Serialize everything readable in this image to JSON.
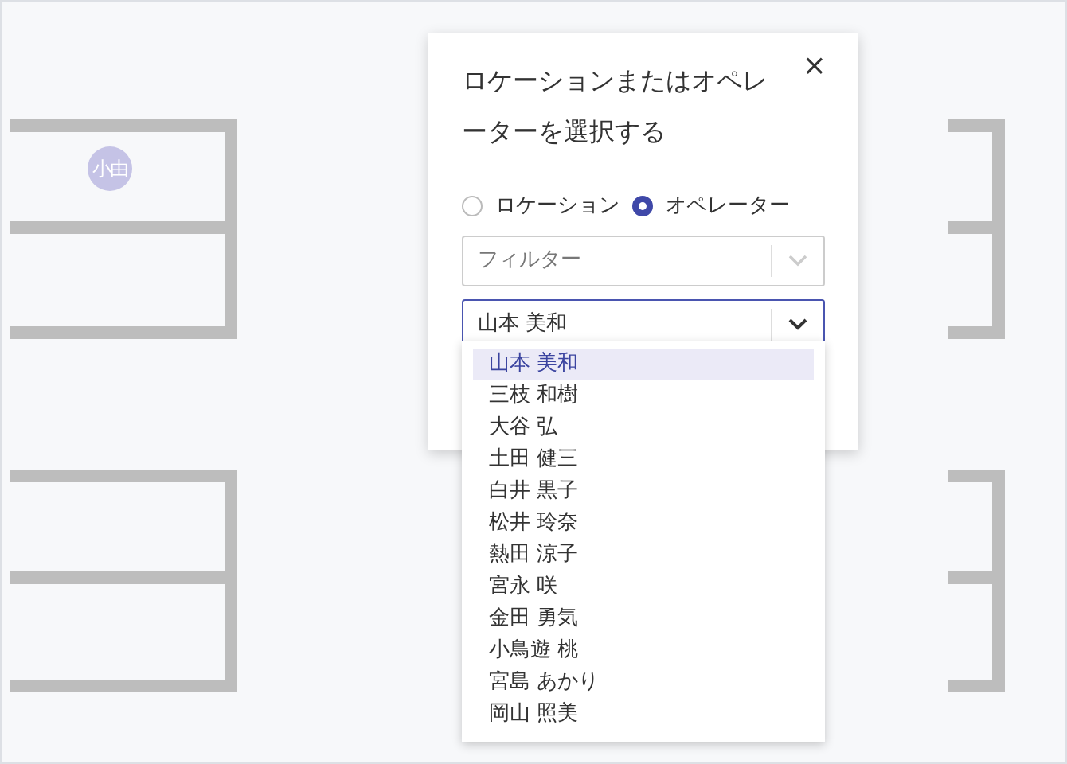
{
  "floor_plan": {
    "avatar": {
      "initials": "小由"
    }
  },
  "dialog": {
    "title": "ロケーションまたはオペレーターを選択する",
    "close": "×",
    "view_options": [
      {
        "label": "ロケーション",
        "selected": false
      },
      {
        "label": "オペレーター",
        "selected": true
      }
    ],
    "filter": {
      "placeholder": "フィルター"
    },
    "operator_select": {
      "value": "山本 美和",
      "expanded": true
    },
    "options": [
      {
        "label": "山本 美和",
        "selected": true
      },
      {
        "label": "三枝 和樹",
        "selected": false
      },
      {
        "label": "大谷 弘",
        "selected": false
      },
      {
        "label": "土田 健三",
        "selected": false
      },
      {
        "label": "白井 黒子",
        "selected": false
      },
      {
        "label": "松井 玲奈",
        "selected": false
      },
      {
        "label": "熱田 涼子",
        "selected": false
      },
      {
        "label": "宮永 咲",
        "selected": false
      },
      {
        "label": "金田 勇気",
        "selected": false
      },
      {
        "label": "小鳥遊 桃",
        "selected": false
      },
      {
        "label": "宮島 あかり",
        "selected": false
      },
      {
        "label": "岡山 照美",
        "selected": false
      }
    ]
  }
}
